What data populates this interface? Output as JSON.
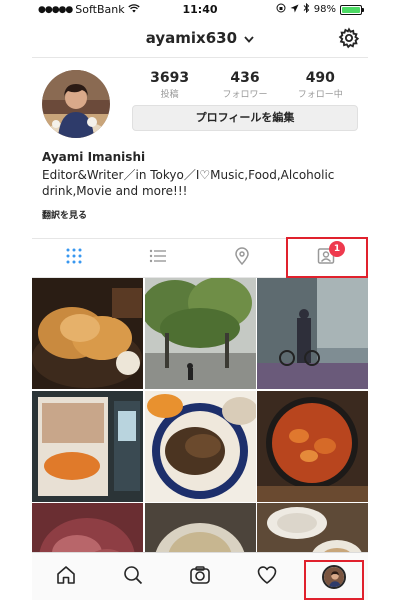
{
  "status_bar": {
    "signal": "●●●●●",
    "carrier": "SoftBank",
    "time": "11:40",
    "battery_text": "98%",
    "battery_level": 0.98
  },
  "nav": {
    "username": "ayamix630",
    "chevron": "⌄"
  },
  "profile": {
    "stats": [
      {
        "value": "3693",
        "label": "投稿"
      },
      {
        "value": "436",
        "label": "フォロワー"
      },
      {
        "value": "490",
        "label": "フォロー中"
      }
    ],
    "edit_button": "プロフィールを編集",
    "name": "Ayami Imanishi",
    "bio_line1": "Editor&Writer／in Tokyo／I♡Music,Food,Alcoholic",
    "bio_line2": "drink,Movie and more!!!",
    "translate": "翻訳を見る"
  },
  "tabs": {
    "tagged_badge": "1"
  },
  "icons": {
    "grid": "grid-icon",
    "list": "list-icon",
    "location": "location-pin-icon",
    "tagged": "tagged-person-icon",
    "home": "home-icon",
    "search": "search-icon",
    "camera": "camera-icon",
    "heart": "heart-icon",
    "profile": "profile-avatar-icon",
    "settings": "gear-icon"
  },
  "colors": {
    "accent_blue": "#3897f0",
    "highlight_red": "#e0212d",
    "badge_red": "#ee3a4e"
  }
}
